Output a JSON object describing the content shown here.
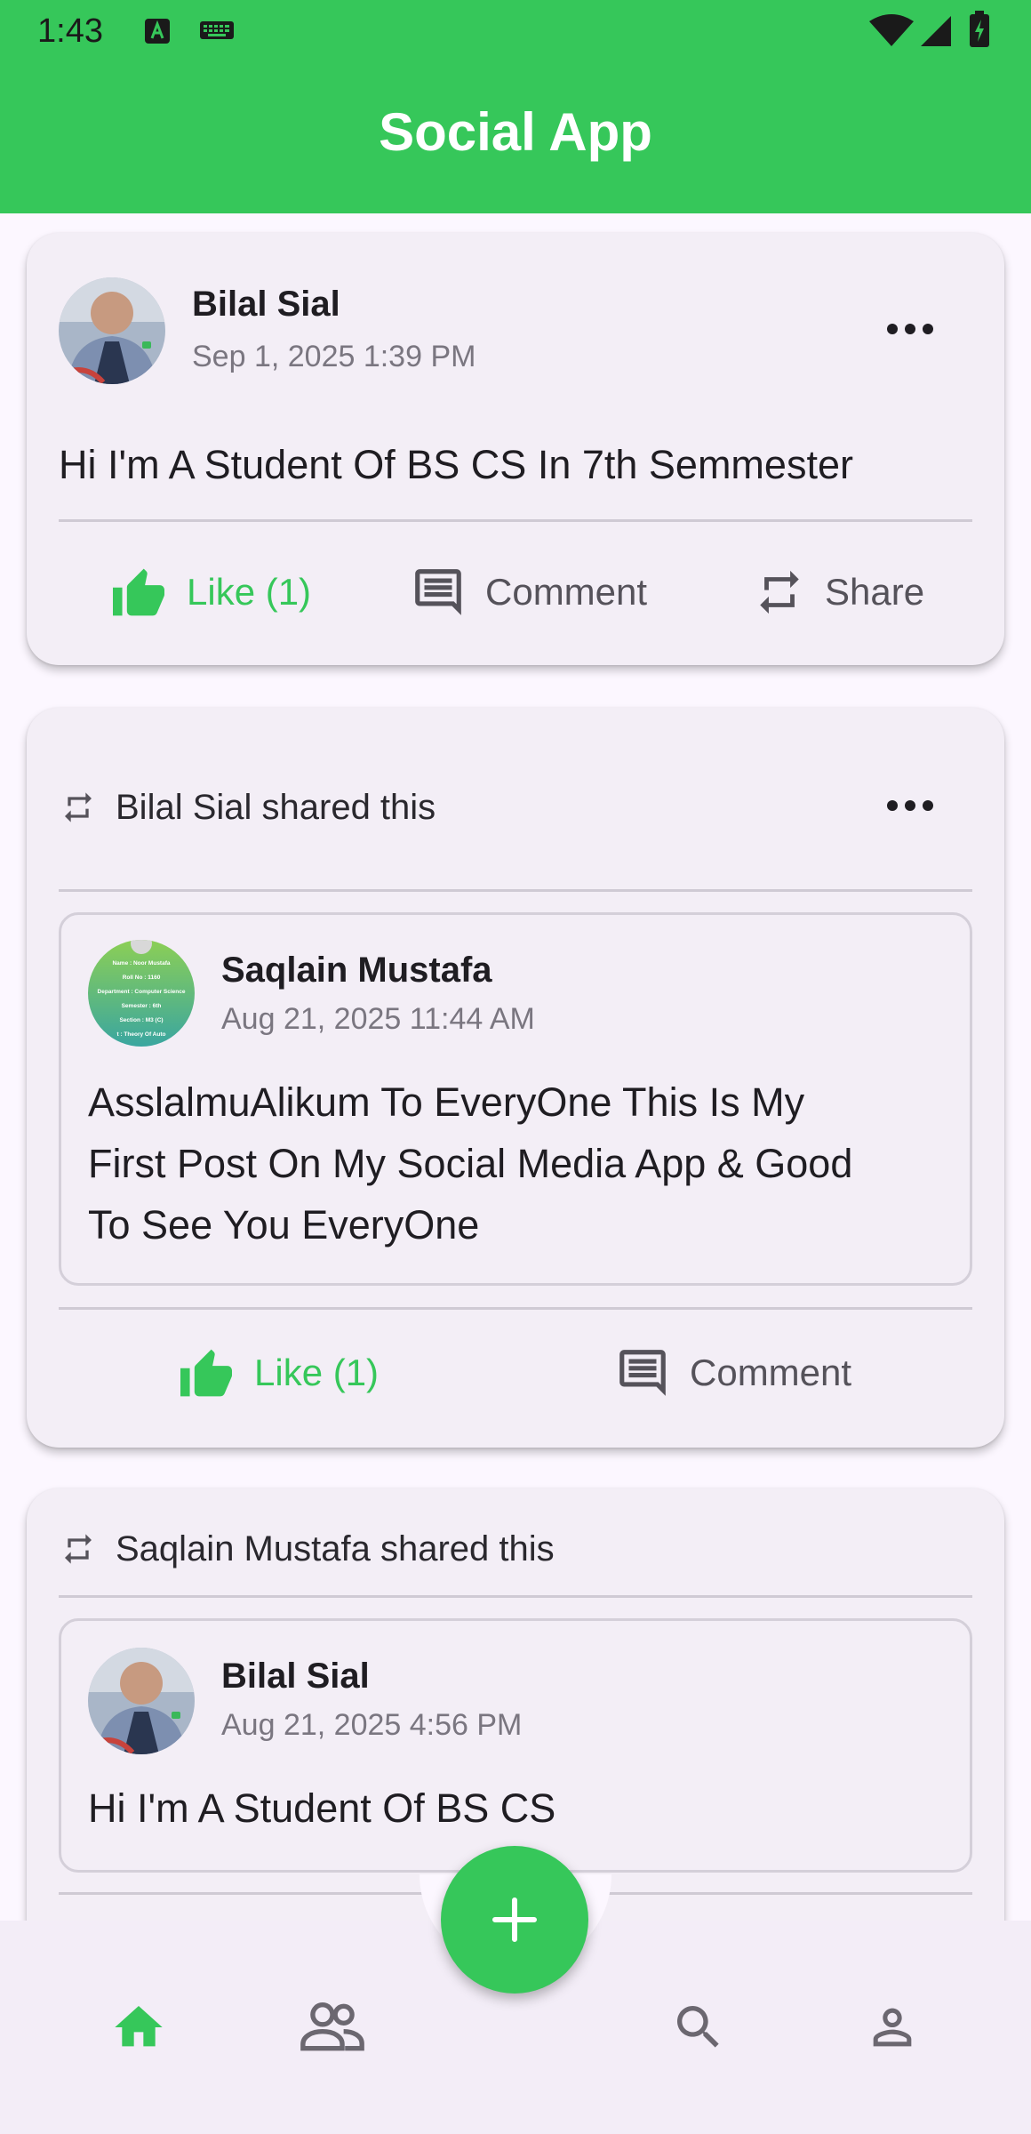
{
  "status_bar": {
    "time": "1:43"
  },
  "app_bar": {
    "title": "Social App"
  },
  "posts": [
    {
      "author": "Bilal Sial",
      "date": "Sep 1, 2025 1:39 PM",
      "text": "Hi I'm A Student Of BS CS In 7th Semmester",
      "actions": {
        "like": "Like (1)",
        "comment": "Comment",
        "share": "Share"
      }
    },
    {
      "shared_by": "Bilal Sial shared this",
      "original": {
        "author": "Saqlain Mustafa",
        "date": "Aug 21, 2025 11:44 AM",
        "text_lines": [
          "AsslalmuAlikum To EveryOne This Is My",
          "First Post On My Social Media App & Good",
          "To See You EveryOne"
        ],
        "avatar_text": [
          "Name : Noor Mustafa",
          "Roll No : 1160",
          "Department : Computer Science",
          "Semester : 6th",
          "Section : M3 (C)",
          "t : Theory Of Auto"
        ]
      },
      "actions": {
        "like": "Like (1)",
        "comment": "Comment"
      }
    },
    {
      "shared_by": "Saqlain Mustafa shared this",
      "original": {
        "author": "Bilal Sial",
        "date": "Aug 21, 2025 4:56 PM",
        "text": "Hi I'm A Student Of BS CS"
      }
    }
  ],
  "bottom_nav": {
    "items": [
      "home-icon",
      "people-icon",
      "search-icon",
      "person-icon"
    ],
    "active": "home-icon"
  },
  "fab": {
    "icon": "plus-icon"
  },
  "colors": {
    "accent": "#36c75a",
    "background": "#fcf7ff",
    "card": "#f3eef6"
  }
}
